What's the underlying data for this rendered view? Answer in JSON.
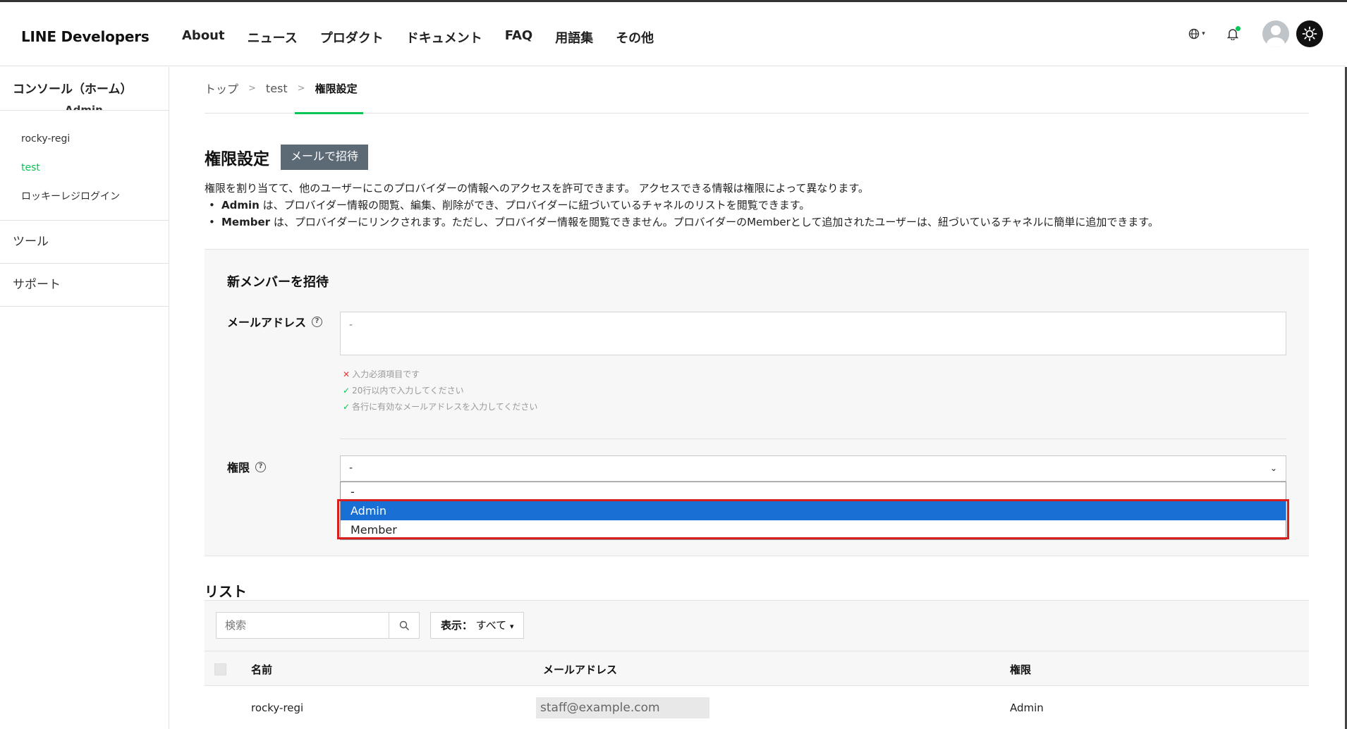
{
  "header": {
    "logo": "LINE Developers",
    "nav": [
      "About",
      "ニュース",
      "プロダクト",
      "ドキュメント",
      "FAQ",
      "用語集",
      "その他"
    ],
    "globe_icon": "globe-icon",
    "bell_icon": "bell-icon",
    "theme_icon": "sun-icon"
  },
  "sidebar": {
    "home": "コンソール（ホーム）",
    "home_cut_text": "Admin",
    "providers": [
      {
        "label": "rocky-regi",
        "active": false
      },
      {
        "label": "test",
        "active": true
      },
      {
        "label": "ロッキーレジログイン",
        "active": false
      }
    ],
    "sections": [
      "ツール",
      "サポート"
    ]
  },
  "breadcrumb": {
    "items": [
      "トップ",
      "test"
    ],
    "current": "権限設定"
  },
  "page": {
    "title": "権限設定",
    "invite_button": "メールで招待",
    "description": "権限を割り当てて、他のユーザーにこのプロバイダーの情報へのアクセスを許可できます。 アクセスできる情報は権限によって異なります。",
    "bullets": [
      {
        "bold": "Admin",
        "text": " は、プロバイダー情報の閲覧、編集、削除ができ、プロバイダーに紐づいているチャネルのリストを閲覧できます。"
      },
      {
        "bold": "Member",
        "text": " は、プロバイダーにリンクされます。ただし、プロバイダー情報を閲覧できません。プロバイダーのMemberとして追加されたユーザーは、紐づいているチャネルに簡単に追加できます。"
      }
    ]
  },
  "invite": {
    "title": "新メンバーを招待",
    "email_label": "メールアドレス",
    "email_placeholder": "-",
    "hints": [
      {
        "status": "error",
        "text": "入力必須項目です"
      },
      {
        "status": "ok",
        "text": "20行以内で入力してください"
      },
      {
        "status": "ok",
        "text": "各行に有効なメールアドレスを入力してください"
      }
    ],
    "role_label": "権限",
    "role_selected": "-",
    "role_options": [
      "-",
      "Admin",
      "Member"
    ],
    "highlighted_option": "Admin"
  },
  "list": {
    "title": "リスト",
    "search_placeholder": "検索",
    "filter_label": "表示：",
    "filter_value": "すべて",
    "columns": [
      "名前",
      "メールアドレス",
      "権限"
    ],
    "rows": [
      {
        "name": "rocky-regi",
        "email": "staff@example.com",
        "role": "Admin"
      }
    ]
  },
  "colors": {
    "accent": "#06c755",
    "select_highlight": "#1a6fd4",
    "highlight_frame": "#d91e1e"
  }
}
